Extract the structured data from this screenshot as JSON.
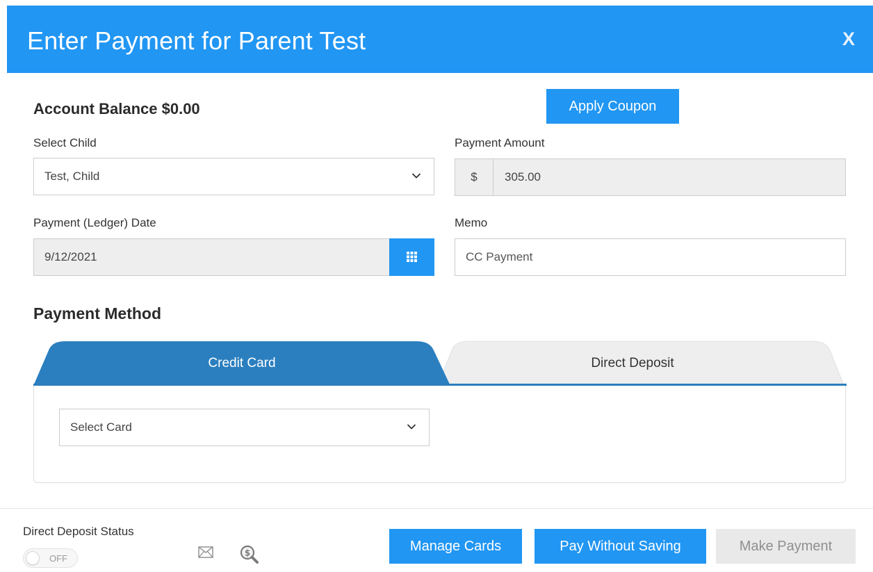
{
  "dialog": {
    "title": "Enter Payment for Parent Test",
    "close_label": "X"
  },
  "account": {
    "balance_label": "Account Balance $0.00"
  },
  "buttons": {
    "apply_coupon": "Apply Coupon",
    "manage_cards": "Manage Cards",
    "pay_without_saving": "Pay Without Saving",
    "make_payment": "Make Payment"
  },
  "form": {
    "select_child_label": "Select Child",
    "select_child_value": "Test, Child",
    "payment_amount_label": "Payment Amount",
    "currency_symbol": "$",
    "payment_amount_value": "305.00",
    "payment_date_label": "Payment (Ledger) Date",
    "payment_date_value": "9/12/2021",
    "memo_label": "Memo",
    "memo_value": "CC Payment"
  },
  "payment_method": {
    "heading": "Payment Method",
    "tabs": [
      {
        "label": "Credit Card",
        "active": true
      },
      {
        "label": "Direct Deposit",
        "active": false
      }
    ],
    "select_card_value": "Select Card"
  },
  "footer": {
    "direct_deposit_status_label": "Direct Deposit Status",
    "toggle_text": "OFF",
    "icons": [
      "envelope-icon",
      "money-search-icon"
    ]
  },
  "colors": {
    "header_blue": "#2196f3",
    "active_tab_blue": "#2b7fbf",
    "inactive_tab": "#eeeeee",
    "disabled_button": "#e9e9e9"
  }
}
